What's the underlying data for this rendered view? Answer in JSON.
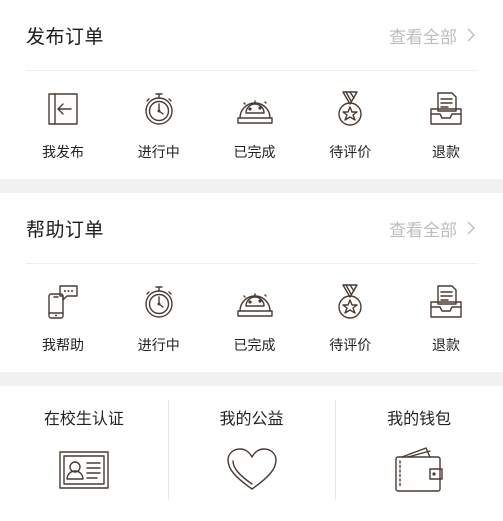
{
  "publish_orders": {
    "title": "发布订单",
    "view_all": "查看全部",
    "items": [
      {
        "label": "我发布",
        "icon": "publish-icon"
      },
      {
        "label": "进行中",
        "icon": "stopwatch-icon"
      },
      {
        "label": "已完成",
        "icon": "snow-globe-icon"
      },
      {
        "label": "待评价",
        "icon": "medal-icon"
      },
      {
        "label": "退款",
        "icon": "inbox-tray-icon"
      }
    ]
  },
  "help_orders": {
    "title": "帮助订单",
    "view_all": "查看全部",
    "items": [
      {
        "label": "我帮助",
        "icon": "phone-chat-icon"
      },
      {
        "label": "进行中",
        "icon": "stopwatch-icon"
      },
      {
        "label": "已完成",
        "icon": "snow-globe-icon"
      },
      {
        "label": "待评价",
        "icon": "medal-icon"
      },
      {
        "label": "退款",
        "icon": "inbox-tray-icon"
      }
    ]
  },
  "bottom": [
    {
      "label": "在校生认证",
      "icon": "id-card-icon"
    },
    {
      "label": "我的公益",
      "icon": "heart-icon"
    },
    {
      "label": "我的钱包",
      "icon": "wallet-icon"
    }
  ],
  "colors": {
    "icon_stroke": "#4b3a31",
    "muted": "#bdbdbd",
    "separator": "#f1f1f1"
  }
}
